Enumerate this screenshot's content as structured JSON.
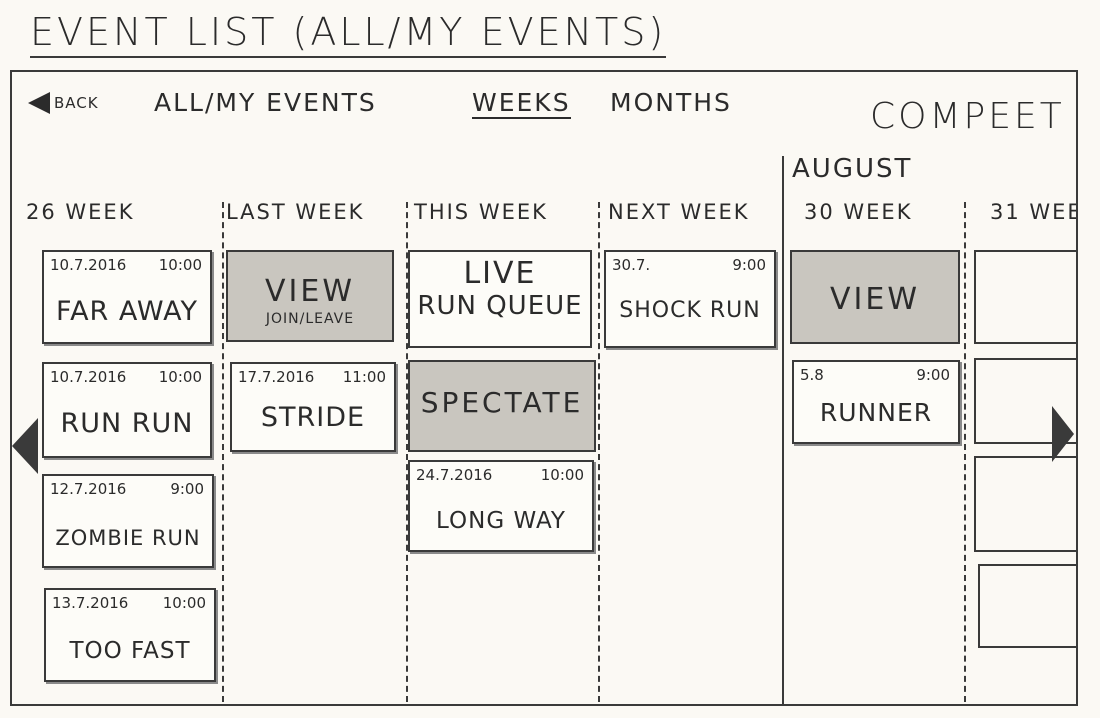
{
  "page": {
    "title": "EVENT LIST (ALL/MY EVENTS)"
  },
  "nav": {
    "back_label": "BACK",
    "all_my_events": "ALL/MY EVENTS",
    "weeks": "WEEKS",
    "months": "MONTHS",
    "brand": "COMPEET"
  },
  "month_label": "AUGUST",
  "columns": [
    {
      "label": "26 WEEK"
    },
    {
      "label": "LAST WEEK"
    },
    {
      "label": "THIS WEEK"
    },
    {
      "label": "NEXT WEEK"
    },
    {
      "label": "30 WEEK"
    },
    {
      "label": "31 WEE"
    }
  ],
  "week26": [
    {
      "date": "10.7.2016",
      "time": "10:00",
      "name": "FAR AWAY"
    },
    {
      "date": "10.7.2016",
      "time": "10:00",
      "name": "RUN RUN"
    },
    {
      "date": "12.7.2016",
      "time": "9:00",
      "name": "ZOMBIE RUN"
    },
    {
      "date": "13.7.2016",
      "time": "10:00",
      "name": "TOO FAST"
    }
  ],
  "last_week": {
    "view_action": {
      "label": "VIEW",
      "sub": "JOIN/LEAVE"
    },
    "events": [
      {
        "date": "17.7.2016",
        "time": "11:00",
        "name": "STRIDE"
      }
    ]
  },
  "this_week": {
    "live": {
      "label": "LIVE",
      "sub": "RUN QUEUE"
    },
    "spectate": {
      "label": "SPECTATE"
    },
    "events": [
      {
        "date": "24.7.2016",
        "time": "10:00",
        "name": "LONG WAY"
      }
    ]
  },
  "next_week": {
    "events": [
      {
        "date": "30.7.",
        "time": "9:00",
        "name": "SHOCK RUN"
      }
    ]
  },
  "week30": {
    "view_action": {
      "label": "VIEW"
    },
    "events": [
      {
        "date": "5.8",
        "time": "9:00",
        "name": "RUNNER"
      }
    ]
  }
}
